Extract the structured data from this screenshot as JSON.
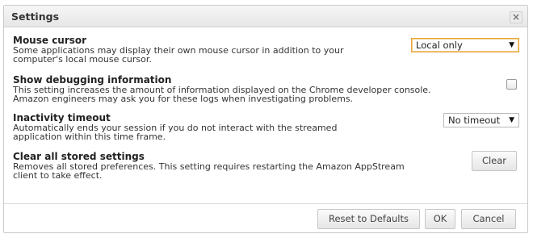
{
  "dialog": {
    "title": "Settings",
    "close_glyph": "×"
  },
  "settings": [
    {
      "heading": "Mouse cursor",
      "desc1": "Some applications may display their own mouse cursor in addition to your",
      "desc2": "computer's local mouse cursor.",
      "control": {
        "type": "select",
        "value": "Local only"
      }
    },
    {
      "heading": "Show debugging information",
      "desc1": "This setting increases the amount of information displayed on the Chrome developer console.",
      "desc2": "Amazon engineers may ask you for these logs when investigating problems.",
      "control": {
        "type": "checkbox",
        "checked": false
      }
    },
    {
      "heading": "Inactivity timeout",
      "desc1": "Automatically ends your session if you do not interact with the streamed",
      "desc2": "application within this time frame.",
      "control": {
        "type": "select",
        "value": "No timeout"
      }
    },
    {
      "heading": "Clear all stored settings",
      "desc1": "Removes all stored preferences. This setting requires restarting the Amazon AppStream",
      "desc2": "client to take effect.",
      "control": {
        "type": "button",
        "label": "Clear"
      }
    }
  ],
  "footer": {
    "reset_label": "Reset to Defaults",
    "ok_label": "OK",
    "cancel_label": "Cancel"
  },
  "icons": {
    "dropdown": "chevron-down-icon",
    "close": "close-icon"
  },
  "colors": {
    "focus_border": "#e6a53a",
    "titlebar": "#eaeaea"
  }
}
